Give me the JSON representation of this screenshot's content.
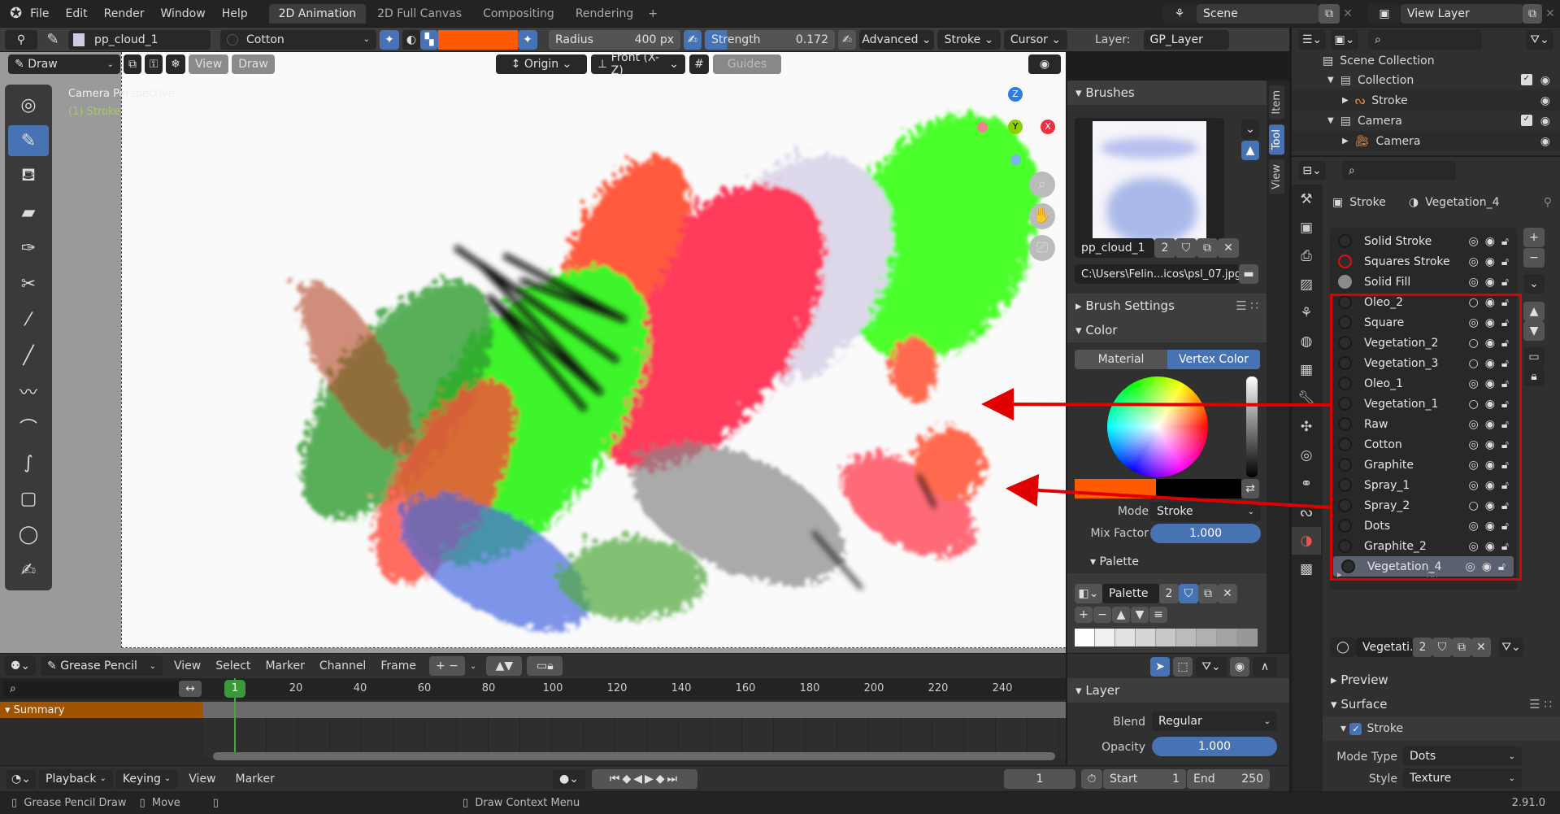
{
  "menubar": {
    "items": [
      "File",
      "Edit",
      "Render",
      "Window",
      "Help"
    ],
    "workspaces": [
      "2D Animation",
      "2D Full Canvas",
      "Compositing",
      "Rendering"
    ],
    "active_workspace": "2D Animation",
    "add_tab": "+",
    "scene": "Scene",
    "view_layer": "View Layer"
  },
  "toolheader": {
    "brush": "pp_cloud_1",
    "material": "Cotton",
    "color": "#ff5a00",
    "radius_label": "Radius",
    "radius_value": "400 px",
    "strength_label": "Strength",
    "strength_value": "0.172",
    "strength_fraction": 0.172,
    "advanced": "Advanced",
    "stroke": "Stroke",
    "cursor": "Cursor",
    "layer_label": "Layer:",
    "layer": "GP_Layer"
  },
  "viewport": {
    "mode": "Draw",
    "view": "View",
    "draw": "Draw",
    "origin": "Origin",
    "orientation": "Front (X-Z)",
    "guides": "Guides",
    "camera_text": "Camera Perspective",
    "object_text": "(1) Stroke",
    "axes": {
      "z": "Z",
      "y": "Y",
      "x": "X"
    }
  },
  "npanel": {
    "tabs": [
      "Item",
      "Tool",
      "View"
    ],
    "active_tab": "Tool",
    "brushes_title": "Brushes",
    "brush_name": "pp_cloud_1",
    "brush_users": "2",
    "brush_path": "C:\\Users\\Felin...icos\\psl_07.jpg",
    "brush_settings": "Brush Settings",
    "color_title": "Color",
    "material_tab": "Material",
    "vertex_tab": "Vertex Color",
    "mode_label": "Mode",
    "mode_value": "Stroke",
    "mix_label": "Mix Factor",
    "mix_value": "1.000",
    "palette_title": "Palette",
    "palette_name": "Palette",
    "palette_users": "2",
    "swatches": [
      "#ffffff",
      "#f0f0f0",
      "#e2e2e2",
      "#d5d5d5",
      "#c8c8c8",
      "#bcbcbc",
      "#b0b0b0",
      "#a4a4a4",
      "#989898"
    ]
  },
  "outliner": {
    "scene_collection": "Scene Collection",
    "items": [
      {
        "name": "Collection",
        "indent": 1
      },
      {
        "name": "Stroke",
        "indent": 2
      },
      {
        "name": "Camera",
        "indent": 1
      },
      {
        "name": "Camera",
        "indent": 2
      }
    ]
  },
  "properties": {
    "object": "Stroke",
    "material": "Vegetation_4",
    "materials": [
      {
        "name": "Solid Stroke",
        "type": "dark",
        "onion": true
      },
      {
        "name": "Squares Stroke",
        "type": "red",
        "onion": true
      },
      {
        "name": "Solid Fill",
        "type": "grey",
        "onion": true
      },
      {
        "name": "Oleo_2",
        "type": "dark",
        "onion": false
      },
      {
        "name": "Square",
        "type": "dark",
        "onion": true
      },
      {
        "name": "Vegetation_2",
        "type": "dark",
        "onion": false
      },
      {
        "name": "Vegetation_3",
        "type": "dark",
        "onion": false
      },
      {
        "name": "Oleo_1",
        "type": "dark",
        "onion": true
      },
      {
        "name": "Vegetation_1",
        "type": "dark",
        "onion": false
      },
      {
        "name": "Raw",
        "type": "dark",
        "onion": true
      },
      {
        "name": "Cotton",
        "type": "dark",
        "onion": true
      },
      {
        "name": "Graphite",
        "type": "dark",
        "onion": true
      },
      {
        "name": "Spray_1",
        "type": "dark",
        "onion": true
      },
      {
        "name": "Spray_2",
        "type": "dark",
        "onion": false
      },
      {
        "name": "Dots",
        "type": "dark",
        "onion": true
      },
      {
        "name": "Graphite_2",
        "type": "dark",
        "onion": true
      },
      {
        "name": "Vegetation_4",
        "type": "dark",
        "onion": true,
        "selected": true
      }
    ],
    "slot_name": "Vegetati...",
    "slot_users": "2",
    "preview": "Preview",
    "surface": "Surface",
    "stroke": "Stroke",
    "mode_type_label": "Mode Type",
    "mode_type": "Dots",
    "style_label": "Style",
    "style": "Texture",
    "highlight_color": "#e00000"
  },
  "timeline": {
    "editor": "Grease Pencil",
    "menus": [
      "View",
      "Select",
      "Marker",
      "Channel",
      "Frame"
    ],
    "current_frame": "1",
    "ticks": [
      "20",
      "40",
      "60",
      "80",
      "100",
      "120",
      "140",
      "160",
      "180",
      "200",
      "220",
      "240"
    ],
    "summary": "Summary"
  },
  "layer_panel": {
    "title": "Layer",
    "blend_label": "Blend",
    "blend": "Regular",
    "opacity_label": "Opacity",
    "opacity": "1.000"
  },
  "playback": {
    "menus": [
      "Playback",
      "Keying",
      "View",
      "Marker"
    ],
    "frame": "1",
    "start_label": "Start",
    "start": "1",
    "end_label": "End",
    "end": "250"
  },
  "status": {
    "left": "Grease Pencil Draw",
    "move": "Move",
    "center": "Draw Context Menu",
    "version": "2.91.0"
  }
}
